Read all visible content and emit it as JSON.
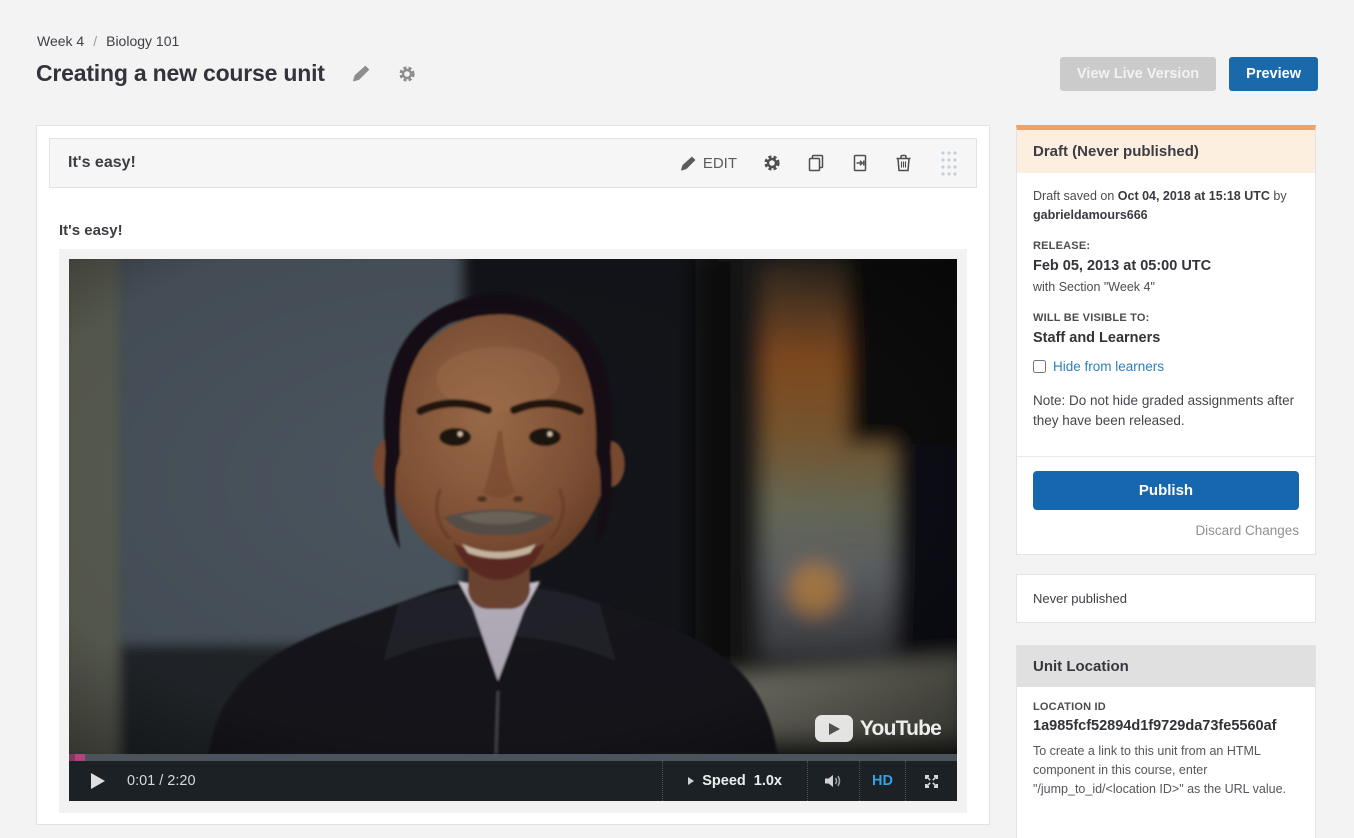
{
  "breadcrumb": {
    "week": "Week 4",
    "separator": "/",
    "course": "Biology 101"
  },
  "page": {
    "title": "Creating a new course unit"
  },
  "header_actions": {
    "view_live": "View Live Version",
    "preview": "Preview"
  },
  "component": {
    "header_title": "It's easy!",
    "edit_label": "EDIT",
    "body_title": "It's easy!"
  },
  "video": {
    "time_display": "0:01 / 2:20",
    "speed_label": "Speed",
    "speed_value": "1.0x",
    "hd_label": "HD",
    "youtube_label": "YouTube"
  },
  "sidebar": {
    "draft": {
      "title": "Draft (Never published)",
      "saved_prefix": "Draft saved on ",
      "saved_date": "Oct 04, 2018 at 15:18 UTC",
      "saved_connector": " by ",
      "saved_user": "gabrieldamours666",
      "release_label": "RELEASE:",
      "release_date": "Feb 05, 2013 at 05:00 UTC",
      "release_section": "with Section \"Week 4\"",
      "visible_label": "WILL BE VISIBLE TO:",
      "visible_value": "Staff and Learners",
      "hide_label": "Hide from learners",
      "note": "Note: Do not hide graded assignments after they have been released.",
      "publish_label": "Publish",
      "discard_label": "Discard Changes"
    },
    "published_status": "Never published",
    "unit_location": {
      "title": "Unit Location",
      "id_label": "LOCATION ID",
      "id_value": "1a985fcf52894d1f9729da73fe5560af",
      "help_text": "To create a link to this unit from an HTML component in this course, enter \"/jump_to_id/<location ID>\" as the URL value."
    }
  },
  "colors": {
    "accent_blue": "#1767ae",
    "draft_orange": "#f0a264",
    "hd_blue": "#36a0e0",
    "progress_handle_pink": "#b5417e"
  }
}
